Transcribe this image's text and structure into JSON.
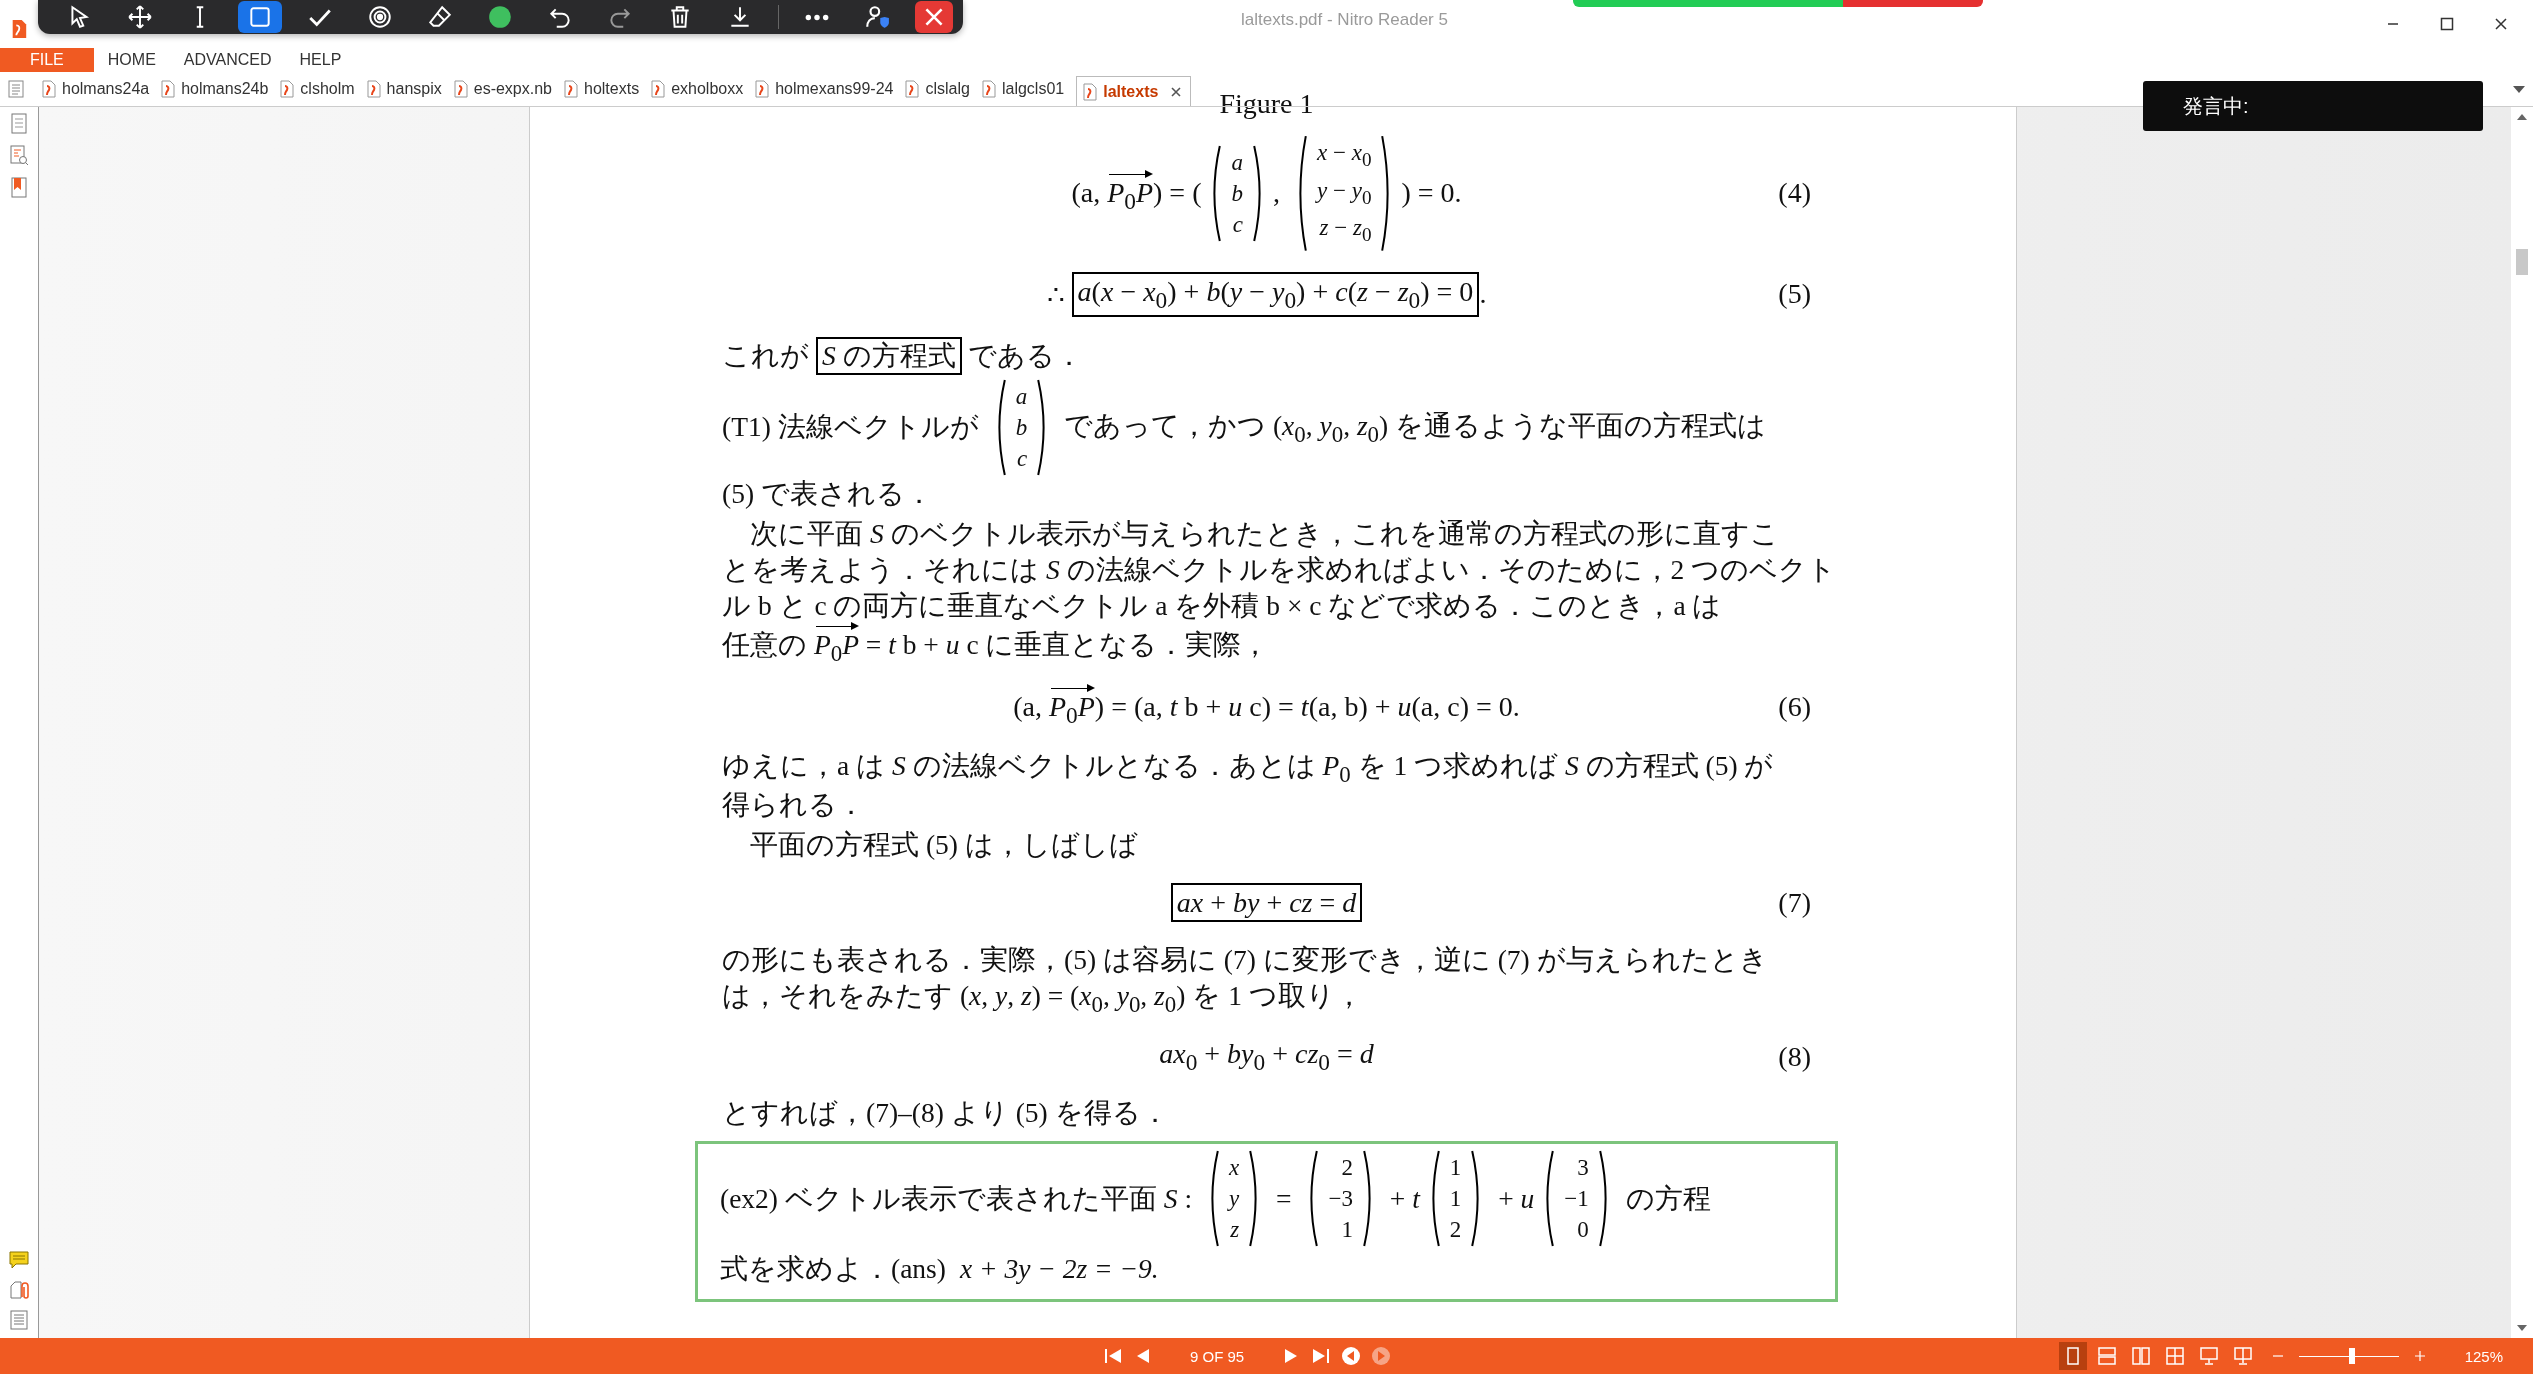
{
  "window": {
    "title": "laltexts.pdf - Nitro Reader 5"
  },
  "toolbar": {
    "tools": [
      {
        "kind": "pointer",
        "selected": false
      },
      {
        "kind": "move",
        "selected": false
      },
      {
        "kind": "text",
        "selected": false
      },
      {
        "kind": "rectangle",
        "selected": true
      },
      {
        "kind": "check",
        "selected": false
      },
      {
        "kind": "target",
        "selected": false
      },
      {
        "kind": "eraser",
        "selected": false
      },
      {
        "kind": "swatch",
        "selected": false
      },
      {
        "kind": "undo",
        "selected": false
      },
      {
        "kind": "redo",
        "selected": false
      },
      {
        "kind": "trash",
        "selected": false
      },
      {
        "kind": "download",
        "selected": false
      }
    ],
    "extra_tools": [
      {
        "kind": "more"
      },
      {
        "kind": "user"
      },
      {
        "kind": "close"
      }
    ]
  },
  "menu": [
    {
      "label": "FILE",
      "selected": true
    },
    {
      "label": "HOME",
      "selected": false
    },
    {
      "label": "ADVANCED",
      "selected": false
    },
    {
      "label": "HELP",
      "selected": false
    }
  ],
  "tabs": [
    {
      "label": "holmans24a",
      "selected": false
    },
    {
      "label": "holmans24b",
      "selected": false
    },
    {
      "label": "clsholm",
      "selected": false
    },
    {
      "label": "hanspix",
      "selected": false
    },
    {
      "label": "es-expx.nb",
      "selected": false
    },
    {
      "label": "holtexts",
      "selected": false
    },
    {
      "label": "exholboxx",
      "selected": false
    },
    {
      "label": "holmexans99-24",
      "selected": false
    },
    {
      "label": "clslalg",
      "selected": false
    },
    {
      "label": "lalgcls01",
      "selected": false
    },
    {
      "label": "laltexts",
      "selected": true
    }
  ],
  "speech_overlay": {
    "text": "発言中:"
  },
  "document": {
    "caption": "Figure 1",
    "blocks": [
      {
        "kind": "equation",
        "number": "(4)",
        "parts": [
          {
            "kind": "text",
            "text": "(a, "
          },
          {
            "kind": "arrow",
            "text": "*P*$_{0}$*P*"
          },
          {
            "kind": "text",
            "text": ") = ("
          },
          {
            "kind": "vec",
            "entries": [
              "*a*",
              "*b*",
              "*c*"
            ]
          },
          {
            "kind": "text",
            "text": ", "
          },
          {
            "kind": "vec",
            "entries": [
              "*x* − *x*$_{0}$",
              "*y* − *y*$_{0}$",
              "*z* − *z*$_{0}$"
            ]
          },
          {
            "kind": "text",
            "text": ") = 0."
          }
        ]
      },
      {
        "kind": "equation",
        "number": "(5)",
        "parts": [
          {
            "kind": "text",
            "text": "∴ "
          },
          {
            "kind": "box",
            "text": "*a*(*x* − *x*$_{0}$) + *b*(*y* − *y*$_{0}$) + *c*(*z* − *z*$_{0}$) = 0"
          },
          {
            "kind": "text",
            "text": "."
          }
        ]
      },
      {
        "kind": "paragraph",
        "lines": [
          [
            {
              "kind": "text",
              "text": "これが "
            },
            {
              "kind": "box",
              "text": "*S* の方程式"
            },
            {
              "kind": "text",
              "text": " である．"
            }
          ]
        ]
      },
      {
        "kind": "paragraph",
        "lines": [
          [
            {
              "kind": "text",
              "text": "(T1) 法線ベクトルが "
            },
            {
              "kind": "vec",
              "entries": [
                "*a*",
                "*b*",
                "*c*"
              ]
            },
            {
              "kind": "text",
              "text": " であって，かつ (*x*$_{0}$, *y*$_{0}$, *z*$_{0}$) を通るような平面の方程式は"
            }
          ],
          [
            {
              "kind": "text",
              "text": "(5) で表される．"
            }
          ]
        ]
      },
      {
        "kind": "paragraph",
        "indent": true,
        "lines": [
          [
            {
              "kind": "text",
              "text": "次に平面 *S* のベクトル表示が与えられたとき，これを通常の方程式の形に直すこ"
            }
          ],
          [
            {
              "kind": "text",
              "text": "とを考えよう．それには *S* の法線ベクトルを求めればよい．そのために，2 つのベクト"
            }
          ],
          [
            {
              "kind": "text",
              "text": "ル b と c の両方に垂直なベクトル a を外積 b × c などで求める．このとき，a は"
            }
          ],
          [
            {
              "kind": "text",
              "text": "任意の "
            },
            {
              "kind": "arrow",
              "text": "*P*$_{0}$*P*"
            },
            {
              "kind": "text",
              "text": " = *t* b + *u* c に垂直となる．実際，"
            }
          ]
        ]
      },
      {
        "kind": "equation",
        "number": "(6)",
        "parts": [
          {
            "kind": "text",
            "text": "(a, "
          },
          {
            "kind": "arrow",
            "text": "*P*$_{0}$*P*"
          },
          {
            "kind": "text",
            "text": ") = (a, *t* b + *u* c) = *t*(a, b) + *u*(a, c) = 0."
          }
        ]
      },
      {
        "kind": "paragraph",
        "lines": [
          [
            {
              "kind": "text",
              "text": "ゆえに，a は *S* の法線ベクトルとなる．あとは *P*$_{0}$ を 1 つ求めれば *S* の方程式 (5) が"
            }
          ],
          [
            {
              "kind": "text",
              "text": "得られる．"
            }
          ]
        ]
      },
      {
        "kind": "paragraph",
        "indent": true,
        "lines": [
          [
            {
              "kind": "text",
              "text": "平面の方程式 (5) は，しばしば"
            }
          ]
        ]
      },
      {
        "kind": "equation",
        "number": "(7)",
        "parts": [
          {
            "kind": "box",
            "text": "*ax* + *by* + *cz* = *d*"
          }
        ]
      },
      {
        "kind": "paragraph",
        "lines": [
          [
            {
              "kind": "text",
              "text": "の形にも表される．実際，(5) は容易に (7) に変形でき，逆に (7) が与えられたとき"
            }
          ],
          [
            {
              "kind": "text",
              "text": "は，それをみたす (*x*, *y*, *z*) = (*x*$_{0}$, *y*$_{0}$, *z*$_{0}$) を 1 つ取り，"
            }
          ]
        ]
      },
      {
        "kind": "equation",
        "number": "(8)",
        "parts": [
          {
            "kind": "text",
            "text": "*ax*$_{0}$ + *by*$_{0}$ + *cz*$_{0}$ = *d*"
          }
        ]
      },
      {
        "kind": "paragraph",
        "lines": [
          [
            {
              "kind": "text",
              "text": "とすれば，(7)–(8) より (5) を得る．"
            }
          ]
        ]
      },
      {
        "kind": "exercise",
        "lines": [
          [
            {
              "kind": "text",
              "text": "(ex2) ベクトル表示で表された平面 *S* : "
            },
            {
              "kind": "vec",
              "entries": [
                "*x*",
                "*y*",
                "*z*"
              ]
            },
            {
              "kind": "text",
              "text": " = "
            },
            {
              "kind": "vec",
              "entries": [
                "2",
                "−3",
                "1"
              ]
            },
            {
              "kind": "text",
              "text": " + *t*"
            },
            {
              "kind": "vec",
              "entries": [
                "1",
                "1",
                "2"
              ]
            },
            {
              "kind": "text",
              "text": " + *u*"
            },
            {
              "kind": "vec",
              "entries": [
                "3",
                "−1",
                "0"
              ]
            },
            {
              "kind": "text",
              "text": " の方程"
            }
          ],
          [
            {
              "kind": "text",
              "text": "式を求めよ．"
            },
            {
              "kind": "text",
              "text": "(ans)"
            },
            {
              "kind": "math",
              "text": "x + 3y − 2z = −9."
            }
          ]
        ]
      }
    ]
  },
  "status_bar": {
    "nav": [
      {
        "kind": "first",
        "disabled": false
      },
      {
        "kind": "prev",
        "disabled": false
      }
    ],
    "page": "9 OF 95",
    "nav_after": [
      {
        "kind": "next",
        "disabled": false
      },
      {
        "kind": "last",
        "disabled": false
      },
      {
        "kind": "back",
        "disabled": false
      },
      {
        "kind": "forward",
        "disabled": true
      }
    ],
    "view_modes": [
      {
        "kind": "single",
        "selected": true
      },
      {
        "kind": "continuous",
        "selected": false
      },
      {
        "kind": "facing",
        "selected": false
      },
      {
        "kind": "grid",
        "selected": false
      },
      {
        "kind": "present",
        "selected": false
      },
      {
        "kind": "book",
        "selected": false
      }
    ],
    "zoom_slider": {
      "level": 0.53
    },
    "zoom": "125%"
  }
}
